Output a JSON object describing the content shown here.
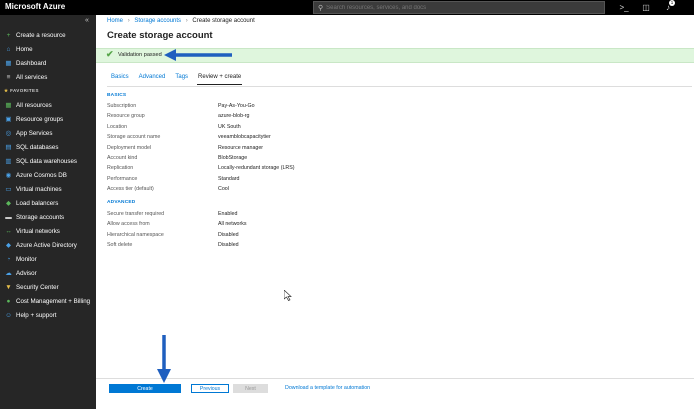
{
  "topbar": {
    "brand": "Microsoft Azure",
    "search_placeholder": "Search resources, services, and docs",
    "notification_count": "1"
  },
  "sidebar": {
    "favorites_label": "FAVORITES",
    "top_items": [
      {
        "label": "Create a resource",
        "icon": "plus-icon",
        "icon_color": "#5bb75b"
      },
      {
        "label": "Home",
        "icon": "home-icon",
        "icon_color": "#4aa0e6"
      },
      {
        "label": "Dashboard",
        "icon": "dashboard-icon",
        "icon_color": "#4aa0e6"
      },
      {
        "label": "All services",
        "icon": "list-icon",
        "icon_color": "#cccccc"
      }
    ],
    "items": [
      {
        "label": "All resources",
        "icon": "grid-icon",
        "icon_color": "#5bb75b"
      },
      {
        "label": "Resource groups",
        "icon": "cube-icon",
        "icon_color": "#4aa0e6"
      },
      {
        "label": "App Services",
        "icon": "globe-icon",
        "icon_color": "#4aa0e6"
      },
      {
        "label": "SQL databases",
        "icon": "database-icon",
        "icon_color": "#4aa0e6"
      },
      {
        "label": "SQL data warehouses",
        "icon": "warehouse-icon",
        "icon_color": "#4aa0e6"
      },
      {
        "label": "Azure Cosmos DB",
        "icon": "cosmos-icon",
        "icon_color": "#4aa0e6"
      },
      {
        "label": "Virtual machines",
        "icon": "monitor-icon",
        "icon_color": "#4aa0e6"
      },
      {
        "label": "Load balancers",
        "icon": "diamond-icon",
        "icon_color": "#5bb75b"
      },
      {
        "label": "Storage accounts",
        "icon": "storage-icon",
        "icon_color": "#cccccc"
      },
      {
        "label": "Virtual networks",
        "icon": "network-icon",
        "icon_color": "#5bb75b"
      },
      {
        "label": "Azure Active Directory",
        "icon": "diamond-icon",
        "icon_color": "#4aa0e6"
      },
      {
        "label": "Monitor",
        "icon": "gauge-icon",
        "icon_color": "#4aa0e6"
      },
      {
        "label": "Advisor",
        "icon": "cloud-icon",
        "icon_color": "#4aa0e6"
      },
      {
        "label": "Security Center",
        "icon": "shield-icon",
        "icon_color": "#e8c04a"
      },
      {
        "label": "Cost Management + Billing",
        "icon": "coin-icon",
        "icon_color": "#5bb75b"
      },
      {
        "label": "Help + support",
        "icon": "person-icon",
        "icon_color": "#4aa0e6"
      }
    ]
  },
  "breadcrumb": [
    "Home",
    "Storage accounts",
    "Create storage account"
  ],
  "page_title": "Create storage account",
  "validation": {
    "message": "Validation passed",
    "color": "#dff6dd"
  },
  "tabs": [
    {
      "label": "Basics",
      "active": false
    },
    {
      "label": "Advanced",
      "active": false
    },
    {
      "label": "Tags",
      "active": false
    },
    {
      "label": "Review + create",
      "active": true
    }
  ],
  "sections": {
    "basics": {
      "heading": "BASICS",
      "rows": [
        {
          "label": "Subscription",
          "value": "Pay-As-You-Go"
        },
        {
          "label": "Resource group",
          "value": "azure-blob-rg"
        },
        {
          "label": "Location",
          "value": "UK South"
        },
        {
          "label": "Storage account name",
          "value": "veeamblobcapacitytier"
        },
        {
          "label": "Deployment model",
          "value": "Resource manager"
        },
        {
          "label": "Account kind",
          "value": "BlobStorage"
        },
        {
          "label": "Replication",
          "value": "Locally-redundant storage (LRS)"
        },
        {
          "label": "Performance",
          "value": "Standard"
        },
        {
          "label": "Access tier (default)",
          "value": "Cool"
        }
      ]
    },
    "advanced": {
      "heading": "ADVANCED",
      "rows": [
        {
          "label": "Secure transfer required",
          "value": "Enabled"
        },
        {
          "label": "Allow access from",
          "value": "All networks"
        },
        {
          "label": "Hierarchical namespace",
          "value": "Disabled"
        },
        {
          "label": "Soft delete",
          "value": "Disabled"
        }
      ]
    }
  },
  "footer": {
    "create_label": "Create",
    "previous_label": "Previous",
    "next_label": "Next",
    "download_label": "Download a template for automation"
  },
  "colors": {
    "accent": "#0078d4",
    "annotation_arrow": "#1f5fbf"
  }
}
